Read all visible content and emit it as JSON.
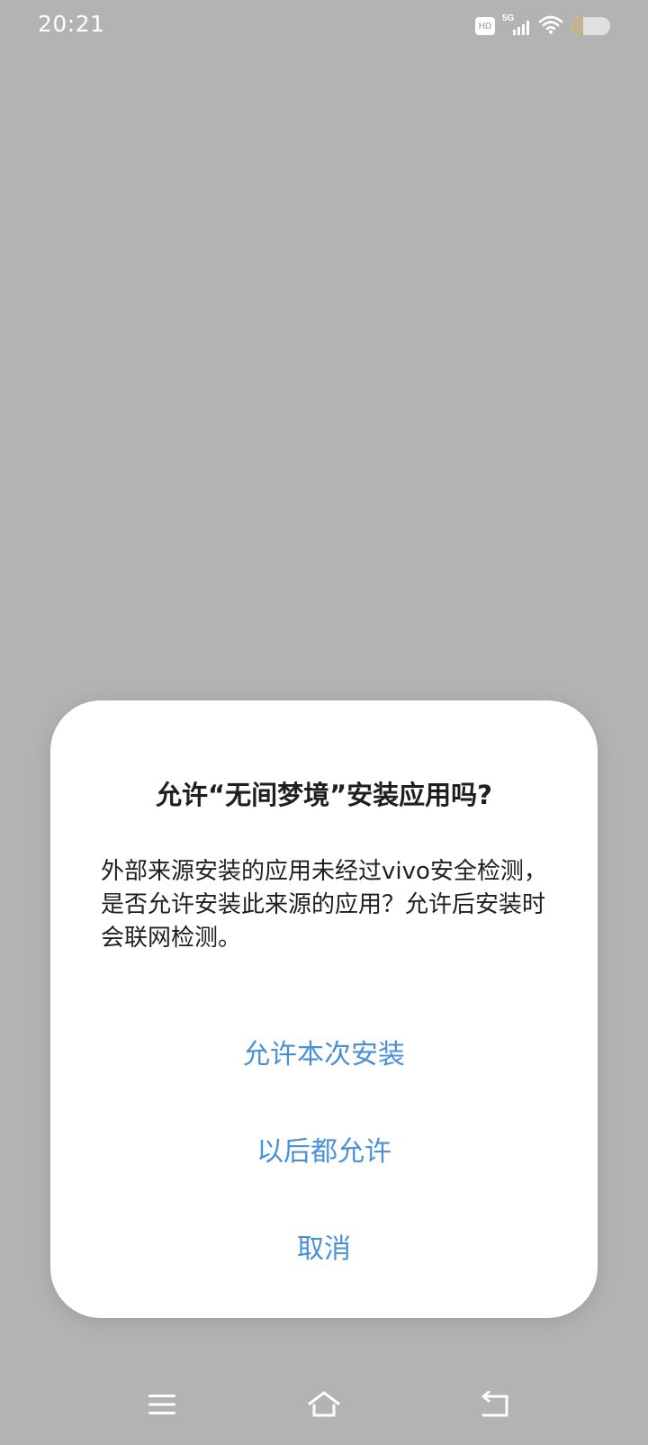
{
  "status_bar": {
    "time": "20:21",
    "hd_label": "HD",
    "network_label": "5G",
    "icons": [
      "hd-icon",
      "signal-5g-icon",
      "wifi-icon",
      "battery-icon"
    ]
  },
  "dialog": {
    "title": "允许“无间梦境”安装应用吗?",
    "message": "外部来源安装的应用未经过vivo安全检测，是否允许安装此来源的应用？允许后安装时会联网检测。",
    "buttons": {
      "allow_once": "允许本次安装",
      "allow_always": "以后都允许",
      "cancel": "取消"
    }
  },
  "nav_bar": {
    "icons": [
      "menu-icon",
      "home-icon",
      "back-icon"
    ]
  },
  "colors": {
    "background_dim": "#b3b3b3",
    "dialog_bg": "#ffffff",
    "accent": "#4a90d9",
    "text": "#1f1f1f",
    "battery_fill": "#c6b28f"
  }
}
